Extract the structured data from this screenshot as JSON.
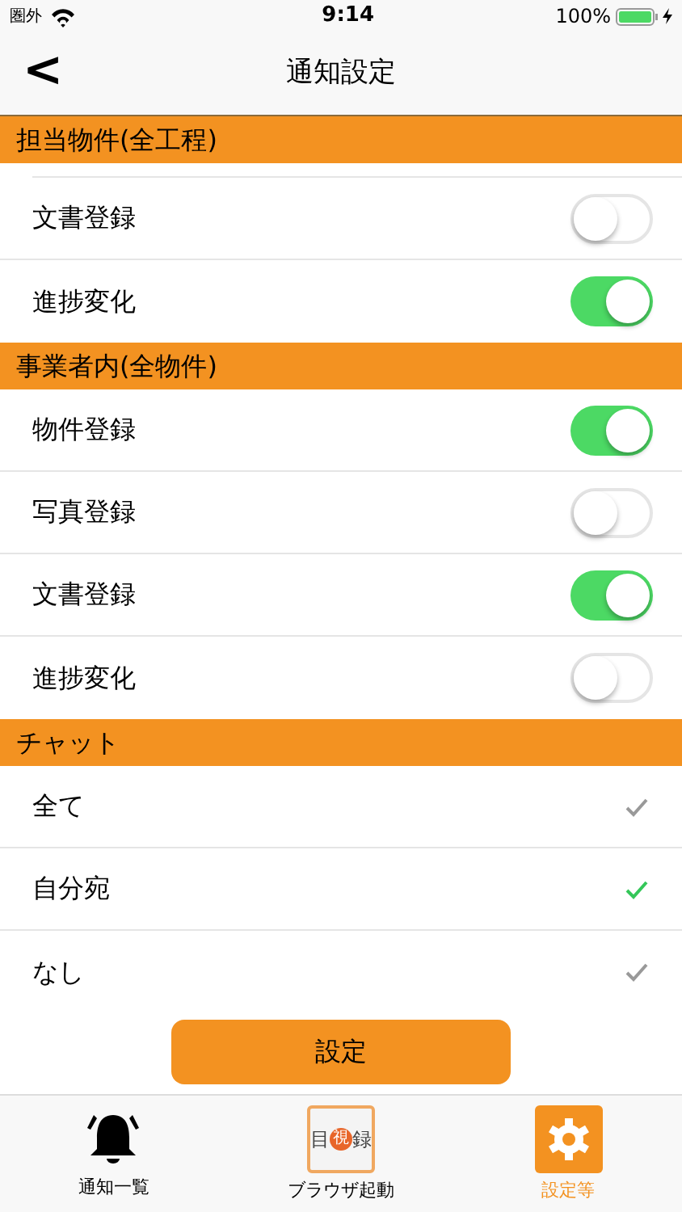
{
  "status_bar": {
    "carrier": "圏外",
    "time": "9:14",
    "battery": "100%"
  },
  "nav": {
    "back": "<",
    "title": "通知設定"
  },
  "sections": [
    {
      "title": "担当物件(全工程)",
      "kind": "toggles",
      "items": [
        {
          "label": "文書登録",
          "on": false
        },
        {
          "label": "進捗変化",
          "on": true
        }
      ]
    },
    {
      "title": "事業者内(全物件)",
      "kind": "toggles",
      "items": [
        {
          "label": "物件登録",
          "on": true
        },
        {
          "label": "写真登録",
          "on": false
        },
        {
          "label": "文書登録",
          "on": true
        },
        {
          "label": "進捗変化",
          "on": false
        }
      ]
    },
    {
      "title": "チャット",
      "kind": "choices",
      "items": [
        {
          "label": "全て",
          "selected": false
        },
        {
          "label": "自分宛",
          "selected": true
        },
        {
          "label": "なし",
          "selected": false
        }
      ]
    }
  ],
  "submit_button": "設定",
  "tab_bar": [
    {
      "label": "通知一覧",
      "kind": "bell",
      "selected": false
    },
    {
      "label": "ブラウザ起動",
      "kind": "app",
      "logo": [
        "目",
        "視",
        "録"
      ],
      "selected": false
    },
    {
      "label": "設定等",
      "kind": "gear",
      "selected": true
    }
  ]
}
